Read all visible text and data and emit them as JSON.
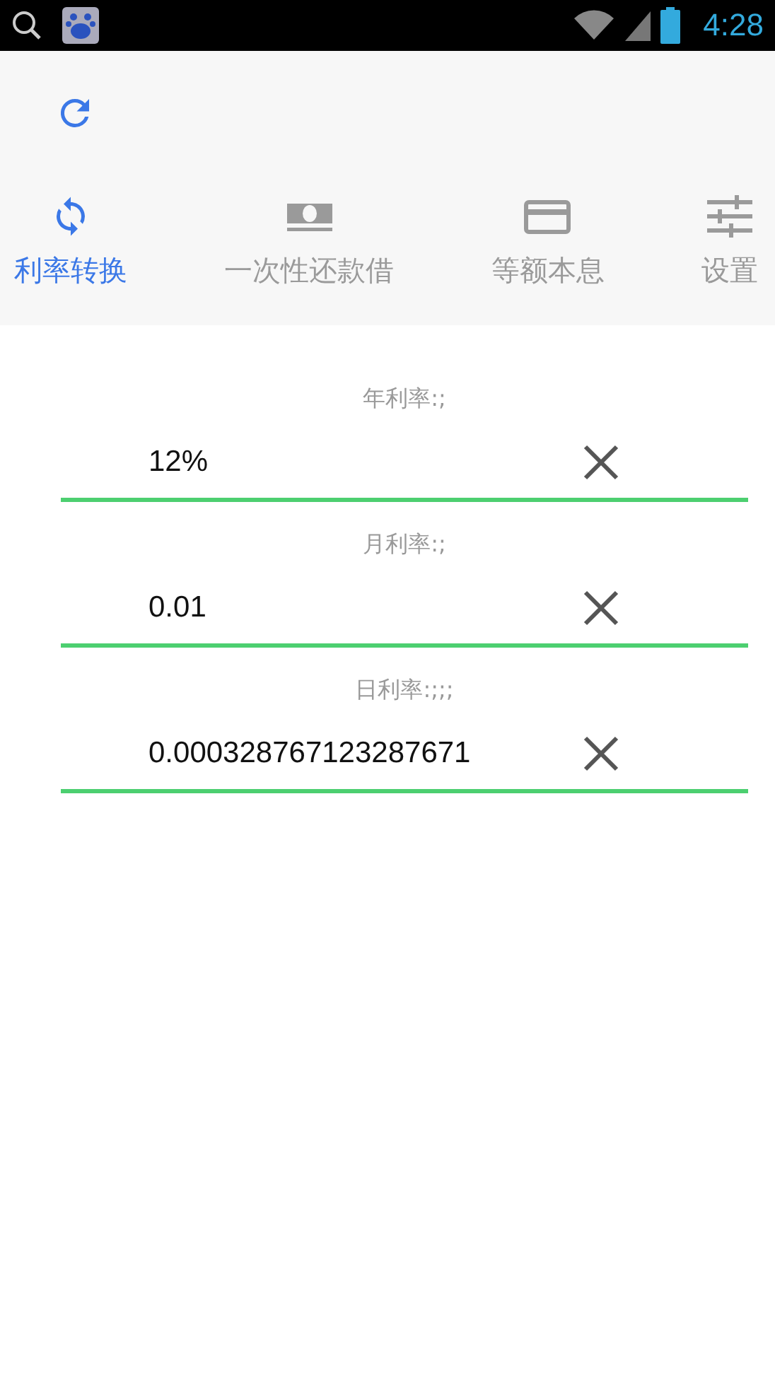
{
  "status_bar": {
    "time": "4:28"
  },
  "tabs": [
    {
      "label": "利率转换",
      "kind": "convert",
      "selected": true
    },
    {
      "label": "一次性还款借",
      "kind": "cash",
      "selected": false
    },
    {
      "label": "等额本息",
      "kind": "card",
      "selected": false
    },
    {
      "label": "设置",
      "kind": "settings",
      "selected": false
    }
  ],
  "fields": [
    {
      "label": "年利率:;",
      "value": "12%"
    },
    {
      "label": "月利率:;",
      "value": "0.01"
    },
    {
      "label": "日利率:;;;",
      "value": "0.000328767123287671"
    }
  ]
}
